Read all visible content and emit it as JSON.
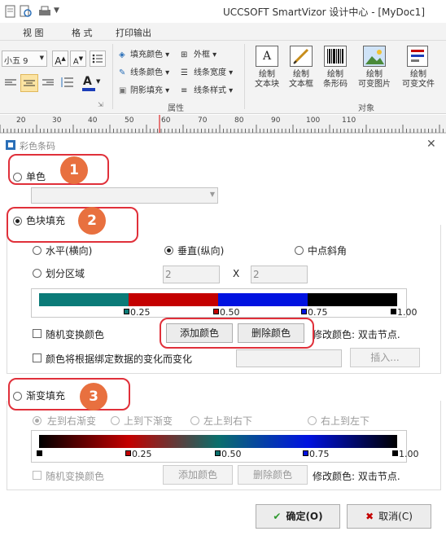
{
  "app": {
    "title": "UCCSOFT SmartVizor 设计中心 - [MyDoc1]"
  },
  "tabs": [
    "视 图",
    "格 式",
    "打印输出"
  ],
  "ribbon": {
    "font_size": "小五 9",
    "fill_color": "填充颜色",
    "line_color": "线条颜色",
    "shadow_fill": "阴影填充",
    "border": "外框",
    "line_width": "线条宽度",
    "line_style": "线条样式",
    "group_property": "属性",
    "draw_text_block": "绘制\n文本块",
    "draw_text_box": "绘制\n文本框",
    "draw_barcode": "绘制\n条形码",
    "draw_var_image": "绘制\n可变图片",
    "draw_var_file": "绘制\n可变文件",
    "group_object": "对象"
  },
  "ruler": [
    "20",
    "30",
    "40",
    "50",
    "60",
    "70",
    "80",
    "90",
    "100",
    "110"
  ],
  "dialog": {
    "title": "彩色条码",
    "close": "✕",
    "solid_label": "单色",
    "block_label": "色块填充",
    "horizontal": "水平(横向)",
    "vertical": "垂直(纵向)",
    "center_diagonal": "中点斜角",
    "divide_regions": "划分区域",
    "region_a": "2",
    "region_x": "X",
    "region_b": "2",
    "block_stops": [
      "0.25",
      "0.50",
      "0.75",
      "1.00"
    ],
    "random_color": "随机变换颜色",
    "add_color": "添加颜色",
    "delete_color": "删除颜色",
    "modify_hint": "修改颜色: 双击节点.",
    "bind_change": "颜色将根据绑定数据的变化而变化",
    "insert": "插入...",
    "gradient_label": "渐变填充",
    "l2r": "左到右渐变",
    "t2b": "上到下渐变",
    "tl2br": "左上到右下",
    "tr2bl": "右上到左下",
    "gradient_stops": [
      "0.25",
      "0.50",
      "0.75",
      "1.00"
    ],
    "random_color2": "随机变换颜色",
    "add_color2": "添加颜色",
    "delete_color2": "删除颜色",
    "modify_hint2": "修改颜色: 双击节点.",
    "ok": "确定(O)",
    "cancel": "取消(C)"
  },
  "annotations": [
    "1",
    "2",
    "3"
  ],
  "colors": {
    "teal": "#0b7b78",
    "red": "#c40000",
    "blue": "#0012e0",
    "black": "#000000",
    "annot": "#e0303a",
    "badge": "#e8703f"
  }
}
